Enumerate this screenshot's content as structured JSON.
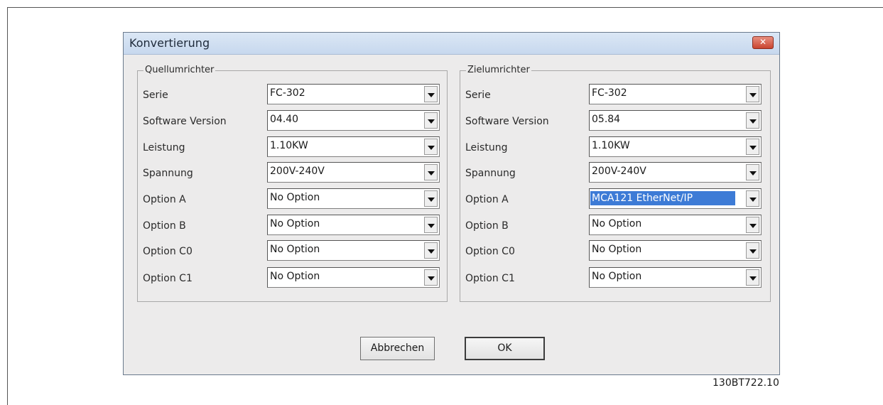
{
  "dialog": {
    "title": "Konvertierung",
    "close_symbol": "✕",
    "close_icon": "close-icon",
    "buttons": {
      "cancel": "Abbrechen",
      "ok": "OK"
    }
  },
  "source": {
    "group_label": "Quellumrichter",
    "rows": [
      {
        "label": "Serie",
        "value": "FC-302"
      },
      {
        "label": "Software Version",
        "value": "04.40"
      },
      {
        "label": "Leistung",
        "value": "1.10KW"
      },
      {
        "label": "Spannung",
        "value": "200V-240V"
      },
      {
        "label": "Option A",
        "value": "No Option"
      },
      {
        "label": "Option B",
        "value": "No Option"
      },
      {
        "label": "Option C0",
        "value": "No Option"
      },
      {
        "label": "Option C1",
        "value": "No Option"
      }
    ]
  },
  "target": {
    "group_label": "Zielumrichter",
    "rows": [
      {
        "label": "Serie",
        "value": "FC-302"
      },
      {
        "label": "Software Version",
        "value": "05.84"
      },
      {
        "label": "Leistung",
        "value": "1.10KW"
      },
      {
        "label": "Spannung",
        "value": "200V-240V"
      },
      {
        "label": "Option A",
        "value": "MCA121 EtherNet/IP",
        "selected": true
      },
      {
        "label": "Option B",
        "value": "No Option"
      },
      {
        "label": "Option C0",
        "value": "No Option"
      },
      {
        "label": "Option C1",
        "value": "No Option"
      }
    ]
  },
  "figure_code": "130BT722.10",
  "colors": {
    "selection": "#3d7bd6",
    "close_button": "#c94530"
  }
}
